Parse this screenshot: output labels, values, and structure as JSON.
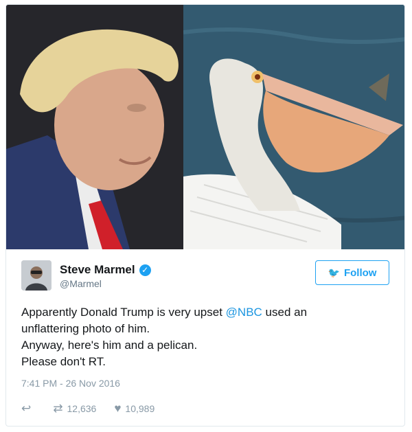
{
  "tweet": {
    "author_name": "Steve Marmel",
    "handle": "@Marmel",
    "follow_label": "Follow",
    "text_parts": {
      "before_mention": "Apparently Donald Trump is very upset ",
      "mention": "@NBC",
      "after_mention": " used an",
      "line2": "unflattering photo of him.",
      "line3": "Anyway, here's him and a pelican.",
      "line4": "Please don't RT."
    },
    "timestamp": "7:41 PM - 26 Nov 2016",
    "retweets": "12,636",
    "likes": "10,989"
  },
  "icons": {
    "verified": "verified-badge-icon",
    "follow": "bird-icon",
    "reply": "reply-icon",
    "retweet": "retweet-icon",
    "like": "heart-icon"
  },
  "colors": {
    "accent": "#1da1f2",
    "mention": "#1b95e0",
    "muted": "#8899a6"
  }
}
